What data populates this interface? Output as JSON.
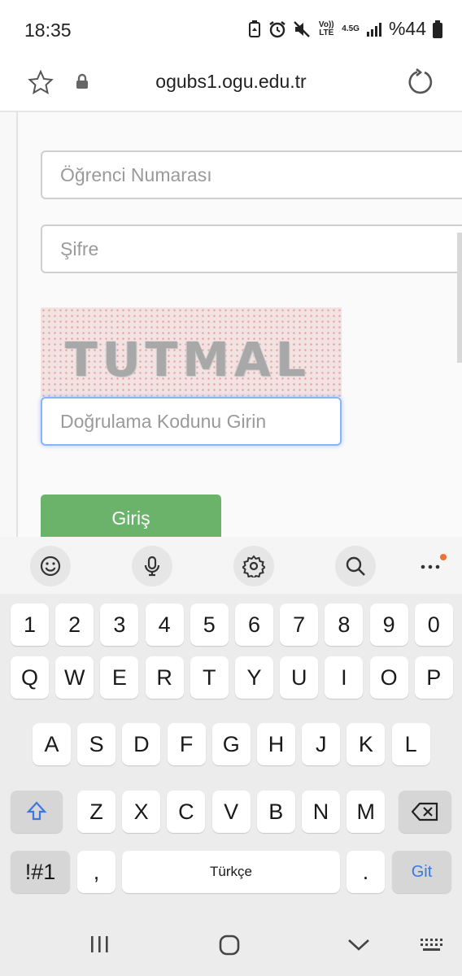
{
  "status": {
    "time": "18:35",
    "volte": "Vo)) LTE",
    "net": "4.5G",
    "battery": "%44"
  },
  "browser": {
    "url": "ogubs1.ogu.edu.tr"
  },
  "form": {
    "student_number_placeholder": "Öğrenci Numarası",
    "password_placeholder": "Şifre",
    "captcha_text": "TUTMAL",
    "captcha_input_placeholder": "Doğrulama Kodunu Girin",
    "login_label": "Giriş"
  },
  "keyboard": {
    "row_numbers": [
      "1",
      "2",
      "3",
      "4",
      "5",
      "6",
      "7",
      "8",
      "9",
      "0"
    ],
    "row1": [
      "Q",
      "W",
      "E",
      "R",
      "T",
      "Y",
      "U",
      "I",
      "O",
      "P"
    ],
    "row2": [
      "A",
      "S",
      "D",
      "F",
      "G",
      "H",
      "J",
      "K",
      "L"
    ],
    "row3": [
      "Z",
      "X",
      "C",
      "V",
      "B",
      "N",
      "M"
    ],
    "symbols_label": "!#1",
    "comma_label": ",",
    "space_label": "Türkçe",
    "period_label": ".",
    "enter_label": "Git",
    "accent_color": "#3a78e0"
  },
  "colors": {
    "login_button": "#6bb36a",
    "focus_border": "#8ab4f8"
  }
}
